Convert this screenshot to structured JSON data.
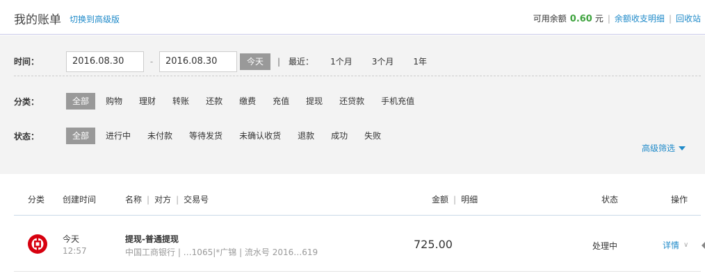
{
  "header": {
    "title": "我的账单",
    "switch_link": "切换到高级版",
    "balance_label": "可用余额",
    "balance_value": "0.60",
    "balance_unit": "元",
    "balance_detail_link": "余额收支明细",
    "recycle_link": "回收站"
  },
  "filters": {
    "time_label": "时间：",
    "start_date": "2016.08.30",
    "date_separator": "-",
    "end_date": "2016.08.30",
    "today_button": "今天",
    "divider": "|",
    "recent_label": "最近：",
    "recent_options": [
      "1个月",
      "3个月",
      "1年"
    ],
    "category_label": "分类：",
    "categories": [
      "全部",
      "购物",
      "理财",
      "转账",
      "还款",
      "缴费",
      "充值",
      "提现",
      "还贷款",
      "手机充值"
    ],
    "status_label": "状态：",
    "statuses": [
      "全部",
      "进行中",
      "未付款",
      "等待发货",
      "未确认收货",
      "退款",
      "成功",
      "失败"
    ],
    "advanced_link": "高级筛选"
  },
  "table": {
    "headers": {
      "category": "分类",
      "created": "创建时间",
      "name": "名称",
      "counterparty": "对方",
      "trade_no": "交易号",
      "amount": "金额",
      "detail": "明细",
      "status": "状态",
      "action": "操作",
      "sep": "|"
    },
    "rows": [
      {
        "day": "今天",
        "time": "12:57",
        "name": "提现-普通提现",
        "sub": "中国工商银行 | …1065|*广锦 | 流水号 2016…619",
        "amount": "725.00",
        "status": "处理中",
        "action": "详情",
        "logo": "icbc-logo"
      }
    ]
  },
  "colors": {
    "link": "#1f8ac9",
    "balance": "#3fa33f",
    "active_chip": "#999999",
    "filter_bg": "#f3f3f3",
    "icbc_red": "#d7000f"
  }
}
